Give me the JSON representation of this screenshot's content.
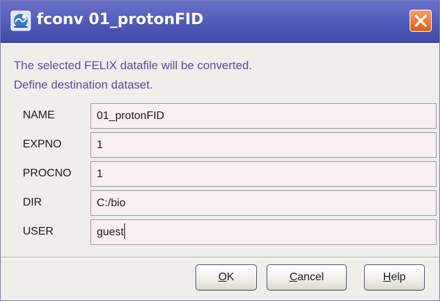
{
  "window": {
    "title": "fconv 01_protonFID",
    "app_icon": "bruker-topspin-icon",
    "close_icon": "close-x-icon",
    "colors": {
      "titlebar": "#545fbd",
      "close_button": "#ee7a35",
      "info_text": "#5a4c9e",
      "field_background": "#f9eef0",
      "dialog_background": "#efeeea"
    }
  },
  "info": {
    "line1": "The selected FELIX datafile will be converted.",
    "line2": "Define destination dataset."
  },
  "fields": [
    {
      "label": "NAME",
      "value": "01_protonFID"
    },
    {
      "label": "EXPNO",
      "value": "1"
    },
    {
      "label": "PROCNO",
      "value": "1"
    },
    {
      "label": "DIR",
      "value": "C:/bio"
    },
    {
      "label": "USER",
      "value": "guest"
    }
  ],
  "buttons": {
    "ok": {
      "mnemonic": "O",
      "rest": "K"
    },
    "cancel": {
      "mnemonic": "C",
      "rest": "ancel"
    },
    "help": {
      "mnemonic": "H",
      "rest": "elp"
    }
  }
}
